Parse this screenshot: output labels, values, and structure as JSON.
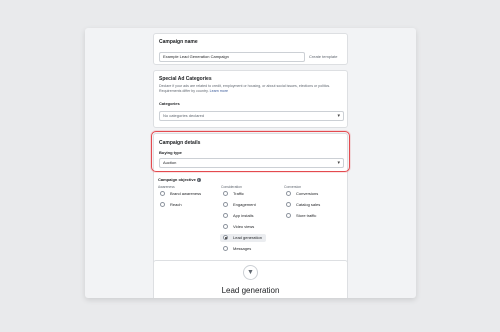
{
  "campaign_name": {
    "title": "Campaign name",
    "value": "Example Lead Generation Campaign",
    "create_template": "Create template"
  },
  "special_ad": {
    "title": "Special Ad Categories",
    "description": "Declare if your ads are related to credit, employment or housing, or about social issues, elections or politics. Requirements differ by country.",
    "learn_more": "Learn more",
    "categories_label": "Categories",
    "categories_value": "No categories declared"
  },
  "campaign_details": {
    "title": "Campaign details",
    "buying_type_label": "Buying type",
    "buying_type_value": "Auction",
    "highlight_color": "#e44a4f"
  },
  "objective": {
    "title": "Campaign objective",
    "columns": [
      {
        "heading": "Awareness",
        "options": [
          "Brand awareness",
          "Reach"
        ]
      },
      {
        "heading": "Consideration",
        "options": [
          "Traffic",
          "Engagement",
          "App installs",
          "Video views",
          "Lead generation",
          "Messages"
        ]
      },
      {
        "heading": "Conversion",
        "options": [
          "Conversions",
          "Catalog sales",
          "Store traffic"
        ]
      }
    ],
    "selected": "Lead generation"
  },
  "selected_panel": {
    "icon": "funnel-icon",
    "title": "Lead generation"
  }
}
